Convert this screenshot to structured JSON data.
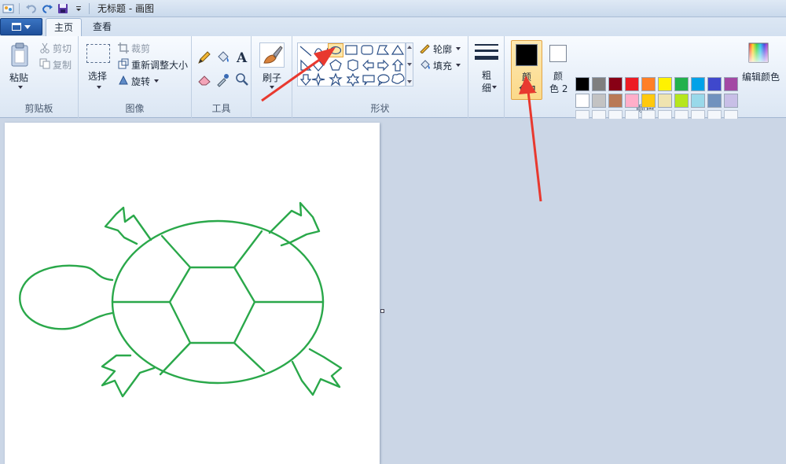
{
  "window": {
    "title": "无标题 - 画图"
  },
  "tabs": [
    {
      "label": "主页"
    },
    {
      "label": "查看"
    }
  ],
  "clipboard": {
    "paste": "粘贴",
    "cut": "剪切",
    "copy": "复制",
    "group": "剪贴板"
  },
  "image": {
    "select": "选择",
    "crop": "裁剪",
    "resize": "重新调整大小",
    "rotate": "旋转",
    "group": "图像"
  },
  "tools": {
    "group": "工具"
  },
  "brushes": {
    "label": "刷子"
  },
  "shapes": {
    "outline": "轮廓",
    "fill": "填充",
    "group": "形状"
  },
  "size": {
    "line1": "粗",
    "line2": "细"
  },
  "colors": {
    "color1_line1": "颜",
    "color1_line2": "色 1",
    "color2_line1": "颜",
    "color2_line2": "色 2",
    "edit": "编辑颜色",
    "group": "颜色",
    "color1_value": "#000000",
    "color2_value": "#ffffff",
    "palette_row1": [
      "#000000",
      "#7f7f7f",
      "#880015",
      "#ed1c24",
      "#ff7f27",
      "#fff200",
      "#22b14c",
      "#00a2e8",
      "#3f48cc",
      "#a349a4"
    ],
    "palette_row2": [
      "#ffffff",
      "#c3c3c3",
      "#b97a57",
      "#ffaec9",
      "#ffc90e",
      "#efe4b0",
      "#b5e61d",
      "#99d9ea",
      "#7092be",
      "#c8bfe7"
    ]
  },
  "drawing": {
    "stroke": "#2aa84a"
  },
  "annotation": {
    "arrow_color": "#e8392f"
  }
}
